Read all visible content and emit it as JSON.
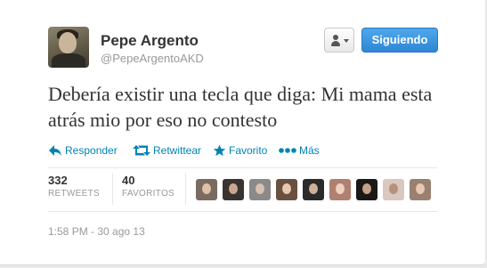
{
  "user": {
    "display_name": "Pepe Argento",
    "screen_name": "@PepeArgentoAKD"
  },
  "header": {
    "user_menu_icon": "person-icon",
    "follow_label": "Siguiendo"
  },
  "tweet": {
    "text": "Debería existir una tecla que diga: Mi mama esta atrás mio por eso no contesto",
    "timestamp": "1:58 PM - 30 ago 13"
  },
  "actions": [
    {
      "name": "reply",
      "label": "Responder",
      "icon": "reply-arrow-icon"
    },
    {
      "name": "retweet",
      "label": "Retwittear",
      "icon": "retweet-icon"
    },
    {
      "name": "favorite",
      "label": "Favorito",
      "icon": "star-icon"
    },
    {
      "name": "more",
      "label": "Más",
      "icon": "more-dots-icon"
    }
  ],
  "stats": {
    "retweets": {
      "count": "332",
      "label": "RETWEETS"
    },
    "favorites": {
      "count": "40",
      "label": "FAVORITOS"
    }
  },
  "favoriters": [
    {
      "bg": "#7a6a60",
      "face": "#e0c0a8"
    },
    {
      "bg": "#3a3430",
      "face": "#c8a890"
    },
    {
      "bg": "#8a8a8a",
      "face": "#d8c0b0"
    },
    {
      "bg": "#6a5040",
      "face": "#e8c8b0"
    },
    {
      "bg": "#2a2a2a",
      "face": "#d0b098"
    },
    {
      "bg": "#b08070",
      "face": "#f0d0c0"
    },
    {
      "bg": "#1a1818",
      "face": "#c8a088"
    },
    {
      "bg": "#d8c8c0",
      "face": "#b89078"
    },
    {
      "bg": "#9a8070",
      "face": "#e8c8b0"
    }
  ],
  "colors": {
    "link": "#0084b4",
    "follow_button": "#2f86d6",
    "text": "#333333",
    "muted": "#999999"
  }
}
